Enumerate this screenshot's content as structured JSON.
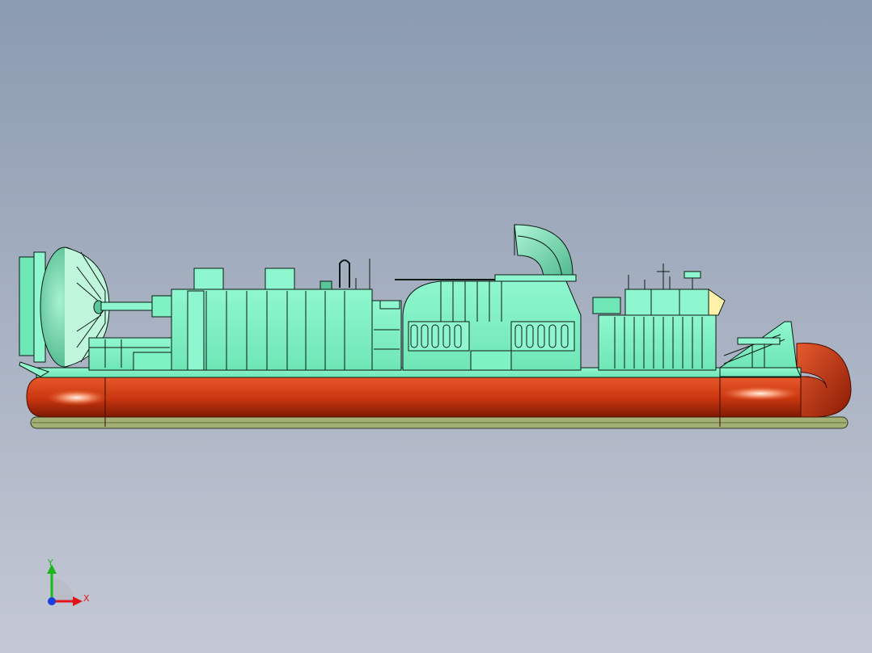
{
  "window": {
    "title": ""
  },
  "viewport": {
    "background_top": "#8b9bb0",
    "background_bottom": "#c4c8d4",
    "model": {
      "description_name": "hovercraft-model",
      "colors": {
        "hull_fill": "#7ff2c4",
        "hull_stroke": "#0b1a12",
        "skirt_fill": "#d9411a",
        "skirt_shade": "#8c1e05",
        "skirt_highlight": "#ffd2b8",
        "base_plate": "#9aa86a"
      }
    }
  },
  "triad": {
    "x_label": "X",
    "y_label": "Y",
    "x_color": "#e0161b",
    "y_color": "#1bb81b",
    "z_color": "#1b3ee0"
  }
}
